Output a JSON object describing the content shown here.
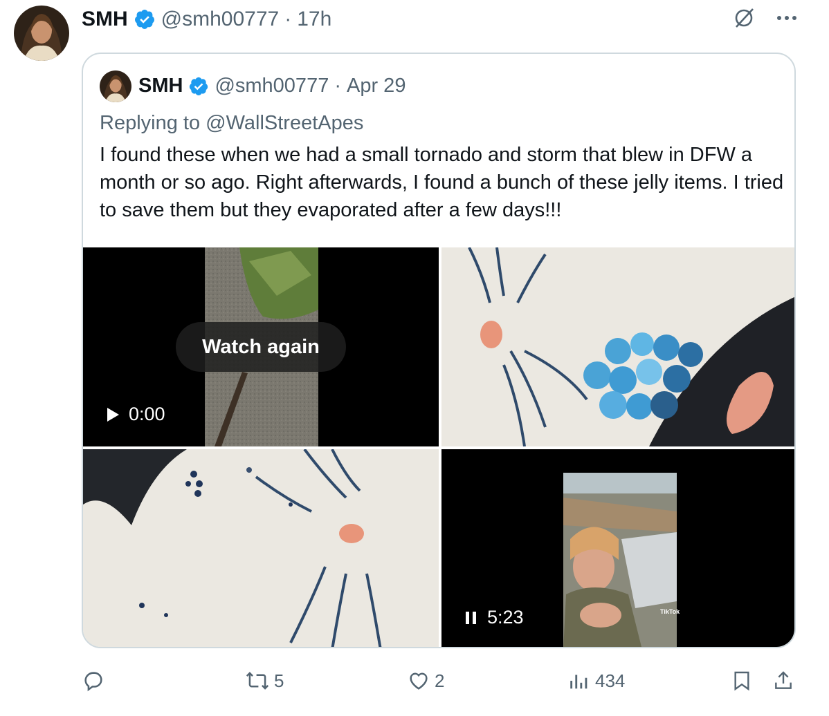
{
  "tweet": {
    "author_name": "SMH",
    "author_handle": "@smh00777",
    "time": "17h",
    "separator": "·"
  },
  "quote": {
    "author_name": "SMH",
    "author_handle": "@smh00777",
    "date": "Apr 29",
    "replying_prefix": "Replying to",
    "replying_handle": "@WallStreetApes",
    "text": "I found these when we had a small tornado and storm that blew in DFW a month or so ago. Right afterwards, I found a bunch of these jelly items. I tried to save them but they evaporated after a few days!!!"
  },
  "media": {
    "video1": {
      "overlay_label": "Watch again",
      "time": "0:00"
    },
    "video2": {
      "time": "5:23",
      "watermark": "TikTok"
    }
  },
  "actions": {
    "reply_count": "",
    "retweet_count": "5",
    "like_count": "2",
    "views_count": "434"
  },
  "icons": [
    "more-icon",
    "grok-icon",
    "verified-icon",
    "reply-icon",
    "retweet-icon",
    "like-icon",
    "views-icon",
    "bookmark-icon",
    "share-icon",
    "play-icon",
    "pause-icon"
  ],
  "colors": {
    "verified": "#1d9bf0",
    "muted": "#536471",
    "border": "#cfd9de"
  }
}
